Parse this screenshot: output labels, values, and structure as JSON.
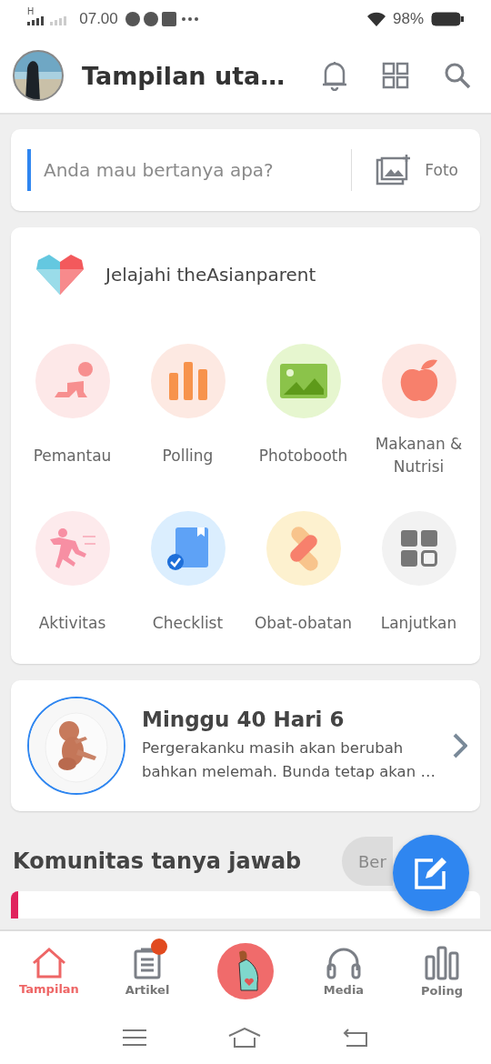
{
  "status_bar": {
    "network": "H",
    "time": "07.00",
    "battery": "98%"
  },
  "header": {
    "title": "Tampilan uta…"
  },
  "ask": {
    "placeholder": "Anda mau bertanya apa?",
    "photo_label": "Foto"
  },
  "explore": {
    "title": "Jelajahi theAsianparent",
    "items": [
      {
        "label": "Pemantau",
        "color": "#fde8e8"
      },
      {
        "label": "Polling",
        "color": "#fde9e2"
      },
      {
        "label": "Photobooth",
        "color": "#e6f6cf"
      },
      {
        "label": "Makanan & Nutrisi",
        "color": "#fde8e4"
      },
      {
        "label": "Aktivitas",
        "color": "#fdeaec"
      },
      {
        "label": "Checklist",
        "color": "#dbeefe"
      },
      {
        "label": "Obat-obatan",
        "color": "#fdf1cf"
      },
      {
        "label": "Lanjutkan",
        "color": "#f2f2f2"
      }
    ]
  },
  "week": {
    "title": "Minggu 40 Hari 6",
    "text_line_1": "Pergerakanku masih akan berubah",
    "text_line_2": "bahkan melemah. Bunda tetap akan …"
  },
  "community": {
    "title": "Komunitas tanya jawab",
    "button": "Ber"
  },
  "bottom_nav": [
    {
      "label": "Tampilan",
      "selected": true,
      "notification": false
    },
    {
      "label": "Artikel",
      "selected": false,
      "notification": true
    },
    {
      "selected": false,
      "notification": false
    },
    {
      "label": "Media",
      "selected": false,
      "notification": false
    },
    {
      "label": "Poling",
      "selected": false,
      "notification": false
    }
  ]
}
